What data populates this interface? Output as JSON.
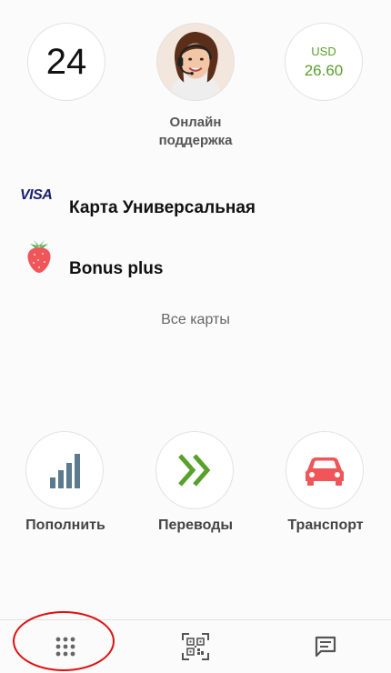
{
  "header": {
    "date_number": "24",
    "support_label_line1": "Онлайн",
    "support_label_line2": "поддержка",
    "currency_code": "USD",
    "currency_rate": "26.60"
  },
  "cards": [
    {
      "logo_text": "VISA",
      "name": "Карта Универсальная"
    },
    {
      "logo_icon": "strawberry-icon",
      "name": "Bonus plus"
    }
  ],
  "all_cards_link": "Все карты",
  "actions": [
    {
      "label": "Пополнить",
      "icon": "signal-bars-icon"
    },
    {
      "label": "Переводы",
      "icon": "double-chevron-right-icon"
    },
    {
      "label": "Транспорт",
      "icon": "car-icon"
    }
  ],
  "tabbar": {
    "items": [
      "menu-grid-icon",
      "qr-code-icon",
      "chat-icon"
    ]
  },
  "colors": {
    "accent_green": "#58a12b",
    "chart_blue": "#5b7a8e",
    "car_red": "#f0555a",
    "annotation_red": "#e01010"
  }
}
